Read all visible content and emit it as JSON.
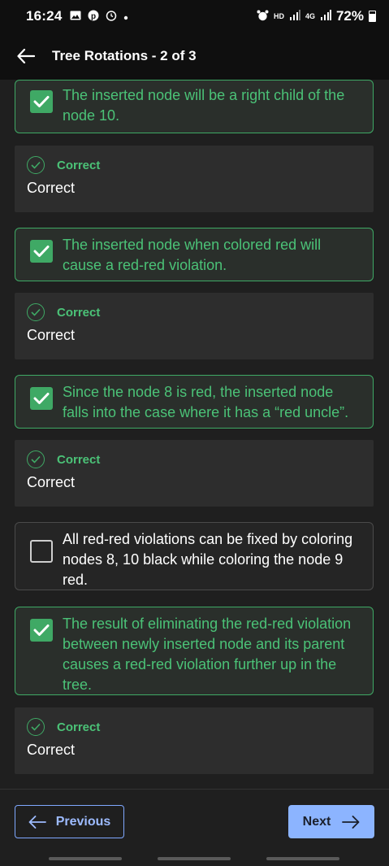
{
  "status": {
    "time": "16:24",
    "network": "HD",
    "signal2": "4G",
    "battery": "72%"
  },
  "appbar": {
    "title": "Tree Rotations - 2 of 3"
  },
  "options": [
    {
      "text": "The inserted node will be a right child of the node 10.",
      "checked": true
    },
    {
      "text": "The inserted node when colored red will cause a red-red violation.",
      "checked": true
    },
    {
      "text": "Since the node 8 is red, the inserted node falls into the case where it has a “red uncle”.",
      "checked": true
    },
    {
      "text": "All red-red violations can be fixed by coloring nodes 8, 10 black while coloring the node 9 red.",
      "checked": false
    },
    {
      "text": "The result of eliminating the red-red violation between newly inserted node and its parent causes a red-red violation further up in the tree.",
      "checked": true
    }
  ],
  "feedback": [
    {
      "label": "Correct",
      "message": "Correct"
    },
    {
      "label": "Correct",
      "message": "Correct"
    },
    {
      "label": "Correct",
      "message": "Correct"
    },
    {
      "label": "Correct",
      "message": "Correct"
    }
  ],
  "footer": {
    "previous_label": "Previous",
    "next_label": "Next"
  },
  "colors": {
    "accent_green": "#4bc277",
    "accent_blue": "#8cb4ff",
    "background": "#1f1f1f"
  }
}
